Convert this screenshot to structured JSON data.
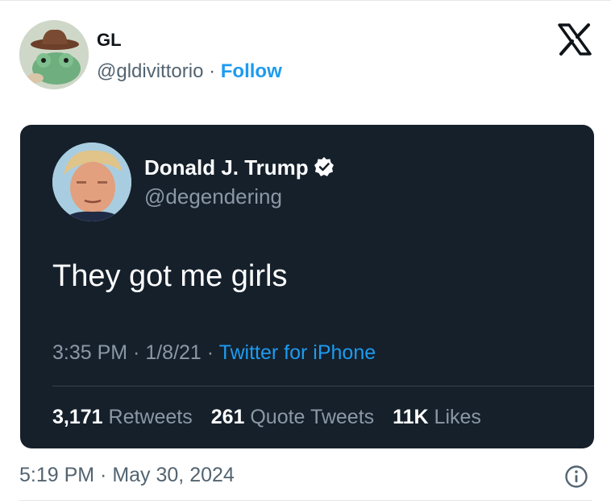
{
  "post": {
    "author_name": "GL",
    "author_handle": "@gldivittorio",
    "separator": "·",
    "follow_label": "Follow",
    "timestamp": "5:19 PM · May 30, 2024"
  },
  "embedded_tweet": {
    "name": "Donald J. Trump",
    "handle": "@degendering",
    "text": "They got me girls",
    "time_date": "3:35 PM · 1/8/21 · ",
    "source": "Twitter for iPhone",
    "stats": {
      "retweets_count": "3,171",
      "retweets_label": "Retweets",
      "quotes_count": "261",
      "quotes_label": "Quote Tweets",
      "likes_count": "11K",
      "likes_label": "Likes"
    }
  },
  "icons": {
    "brand": "x-logo-icon",
    "verified": "verified-badge-icon",
    "info": "info-icon"
  },
  "colors": {
    "link_blue": "#1d9bf0",
    "embed_bg": "#15202b",
    "muted_gray": "#536471",
    "dark_muted": "#8b98a5"
  }
}
